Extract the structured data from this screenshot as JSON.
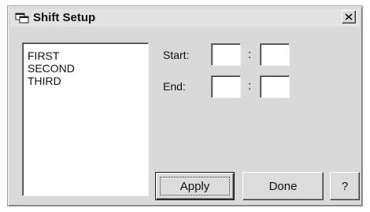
{
  "window": {
    "title": "Shift Setup",
    "icon": "app-window-icon",
    "close_icon": "close-icon"
  },
  "shift_list": {
    "items": [
      "FIRST",
      "SECOND",
      "THIRD"
    ]
  },
  "start": {
    "label": "Start:",
    "separator": ":",
    "hour": "",
    "minute": ""
  },
  "end": {
    "label": "End:",
    "separator": ":",
    "hour": "",
    "minute": ""
  },
  "buttons": {
    "apply": "Apply",
    "done": "Done",
    "help": "?"
  }
}
